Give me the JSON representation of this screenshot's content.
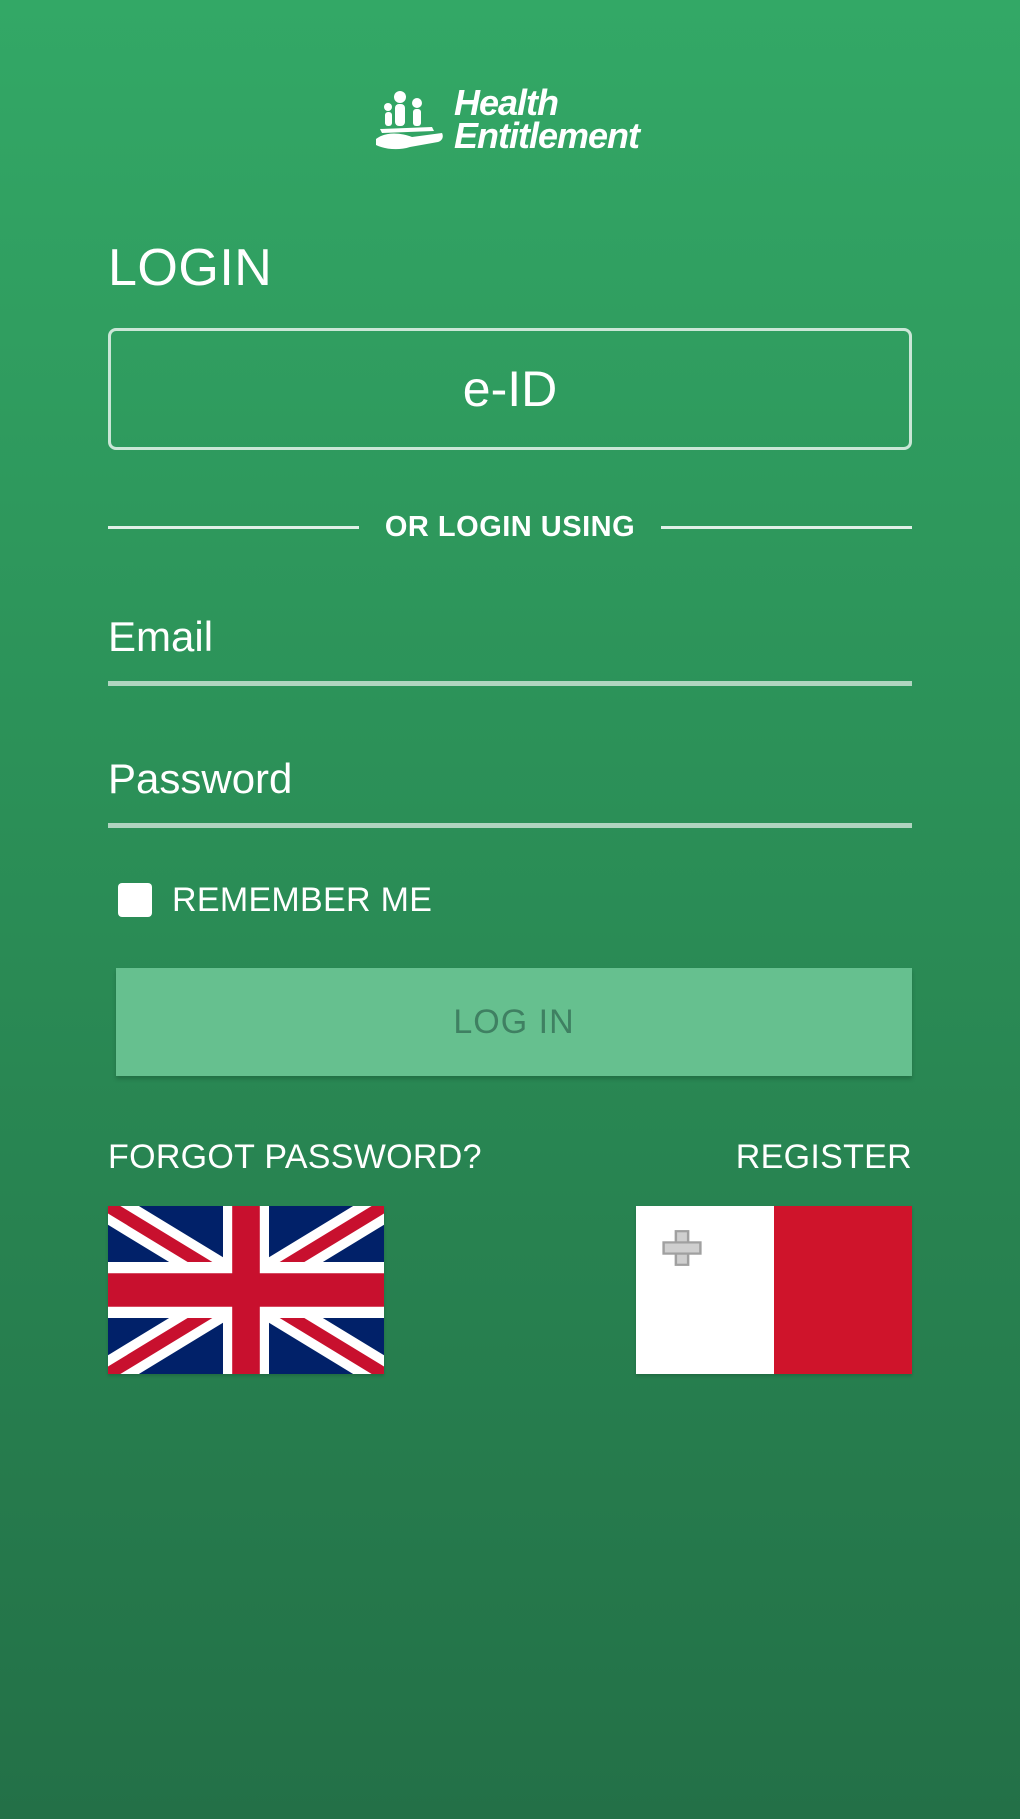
{
  "app": {
    "logo_line1": "Health",
    "logo_line2": "Entitlement"
  },
  "login": {
    "heading": "LOGIN",
    "eid_label": "e-ID",
    "divider_text": "OR LOGIN USING",
    "email_placeholder": "Email",
    "email_value": "",
    "password_placeholder": "Password",
    "password_value": "",
    "remember_label": "REMEMBER ME",
    "remember_checked": false,
    "login_button": "LOG IN",
    "forgot_password": "FORGOT PASSWORD?",
    "register": "REGISTER"
  },
  "languages": [
    {
      "name": "English",
      "icon": "uk-flag-icon"
    },
    {
      "name": "Maltese",
      "icon": "malta-flag-icon"
    }
  ],
  "colors": {
    "background_top": "#33a866",
    "background_bottom": "#237047",
    "login_button": "#66c08f",
    "login_button_text": "#3f8062"
  }
}
